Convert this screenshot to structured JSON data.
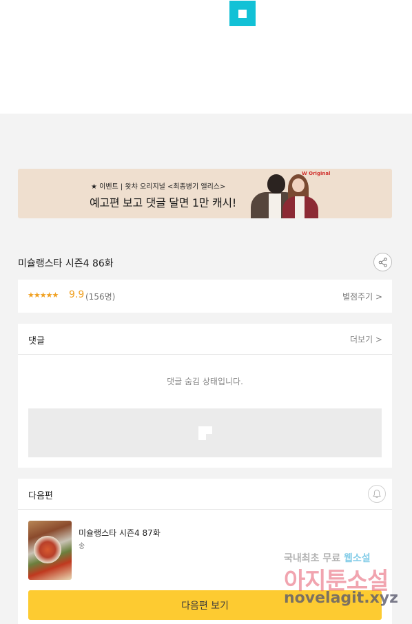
{
  "banner": {
    "line1": "★ 이벤트 | 왓챠 오리지널 <최종병기 앨리스>",
    "line2": "예고편 보고 댓글 달면 1만 캐시!",
    "brand": "W Original"
  },
  "episode": {
    "title": "미슐랭스타 시즌4 86화"
  },
  "rating": {
    "stars": "★★★★★",
    "score": "9.9",
    "count": "(156명)",
    "rate_link": "별점주기 >"
  },
  "comments": {
    "label": "댓글",
    "more": "더보기 >",
    "hidden_message": "댓글 숨김 상태입니다."
  },
  "next": {
    "label": "다음편",
    "title": "미슐랭스타 시즌4 87화",
    "subtitle": "송",
    "button": "다음편 보기"
  },
  "watermark": {
    "line1_a": "국내최초 무료",
    "line1_b": "웹소설",
    "line2": "아지툰소설",
    "line3": "novelagit.xyz"
  },
  "colors": {
    "accent_cyan": "#12c1d6",
    "star": "#f0a020",
    "next_button": "#fdcb31",
    "banner_bg": "#efdfcf"
  }
}
